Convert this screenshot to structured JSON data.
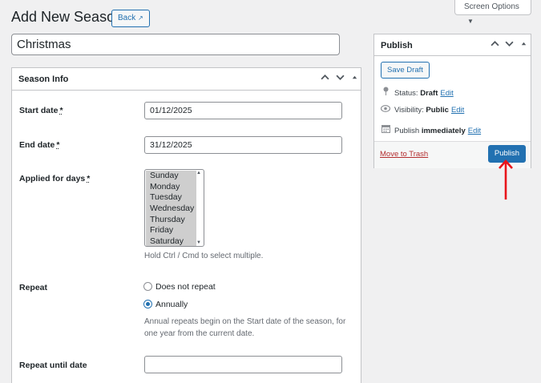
{
  "header": {
    "title": "Add New Season",
    "back_label": "Back",
    "back_icon": "external-arrow-icon",
    "screen_options_label": "Screen Options",
    "screen_options_icon": "caret-down-icon"
  },
  "title_input": {
    "value": "Christmas"
  },
  "season_info": {
    "title": "Season Info",
    "controls": [
      "chevron-up-icon",
      "chevron-down-icon",
      "caret-up-icon"
    ],
    "start_date": {
      "label": "Start date",
      "required_mark": "*",
      "value": "01/12/2025"
    },
    "end_date": {
      "label": "End date",
      "required_mark": "*",
      "value": "31/12/2025"
    },
    "applied_days": {
      "label": "Applied for days",
      "required_mark": "*",
      "options": [
        "Sunday",
        "Monday",
        "Tuesday",
        "Wednesday",
        "Thursday",
        "Friday",
        "Saturday"
      ],
      "hint": "Hold Ctrl / Cmd to select multiple."
    },
    "repeat": {
      "label": "Repeat",
      "options": [
        {
          "label": "Does not repeat",
          "checked": false
        },
        {
          "label": "Annually",
          "checked": true
        }
      ],
      "hint_line1": "Annual repeats begin on the Start date of the season, for",
      "hint_line2": "one year from the current date."
    },
    "repeat_until": {
      "label": "Repeat until date",
      "value": ""
    }
  },
  "publish": {
    "title": "Publish",
    "save_draft_label": "Save Draft",
    "status": {
      "prefix": "Status:",
      "value": "Draft",
      "link": "Edit",
      "icon": "pin-icon"
    },
    "visibility": {
      "prefix": "Visibility:",
      "value": "Public",
      "link": "Edit",
      "icon": "eye-icon"
    },
    "schedule": {
      "prefix": "Publish",
      "value": "immediately",
      "link": "Edit",
      "icon": "calendar-icon"
    },
    "trash_label": "Move to Trash",
    "publish_label": "Publish"
  },
  "colors": {
    "accent": "#2271b1",
    "danger": "#b32d2e",
    "annotation_arrow": "#e8141b"
  }
}
